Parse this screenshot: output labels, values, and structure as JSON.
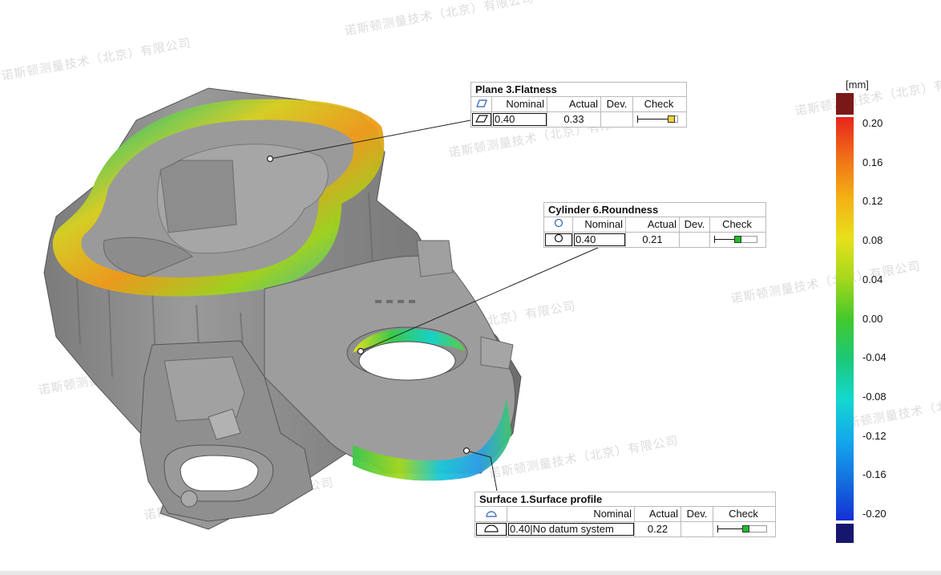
{
  "watermark": "诺斯顿测量技术（北京）有限公司",
  "annotations": {
    "flatness": {
      "title": "Plane 3.Flatness",
      "headers": [
        "Nominal",
        "Actual",
        "Dev.",
        "Check"
      ],
      "nominal": "0.40",
      "actual": "0.33",
      "dev": "",
      "check_fraction": 0.82,
      "check_color": "#f2d33a",
      "icon": "flatness-parallelogram-icon"
    },
    "roundness": {
      "title": "Cylinder 6.Roundness",
      "headers": [
        "Nominal",
        "Actual",
        "Dev.",
        "Check"
      ],
      "nominal": "0.40",
      "actual": "0.21",
      "dev": "",
      "check_fraction": 0.52,
      "check_color": "#1fbf2a",
      "icon": "roundness-circle-icon"
    },
    "surface": {
      "title": "Surface 1.Surface profile",
      "headers": [
        "Nominal",
        "Actual",
        "Dev.",
        "Check"
      ],
      "nominal": "0.40|No datum system",
      "actual": "0.22",
      "dev": "",
      "check_fraction": 0.55,
      "check_color": "#1fbf2a",
      "icon": "surface-profile-arc-icon"
    }
  },
  "color_scale": {
    "unit": "[mm]",
    "ticks": [
      "0.20",
      "0.16",
      "0.12",
      "0.08",
      "0.04",
      "0.00",
      "-0.04",
      "-0.08",
      "-0.12",
      "-0.16",
      "-0.20"
    ],
    "over_color": "#7a1818",
    "under_color": "#16166e",
    "gradient": [
      "#e8241c",
      "#f07018",
      "#f4b014",
      "#e8e01c",
      "#a6d81c",
      "#44c82c",
      "#1cc878",
      "#14d8d0",
      "#14a8ec",
      "#1470e0",
      "#1430d4"
    ]
  },
  "surface_colors": {
    "gray_light": "#a9a9a9",
    "gray_mid": "#8a8a8a",
    "gray_dark": "#6a6a6a"
  }
}
